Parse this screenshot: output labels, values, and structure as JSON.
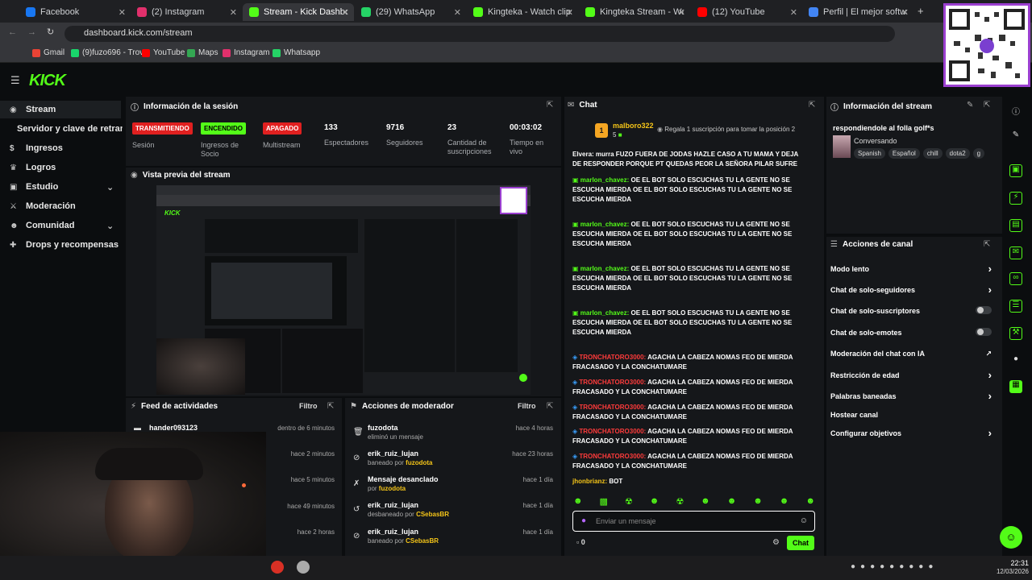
{
  "browser": {
    "tabs": [
      {
        "label": "Facebook",
        "color": "#1877f2"
      },
      {
        "label": "(2) Instagram",
        "color": "#e1306c"
      },
      {
        "label": "Stream - Kick Dashboard",
        "color": "#53fc18"
      },
      {
        "label": "(29) WhatsApp",
        "color": "#25d366"
      },
      {
        "label": "Kingteka - Watch clips on",
        "color": "#53fc18"
      },
      {
        "label": "Kingteka Stream - Watch",
        "color": "#53fc18"
      },
      {
        "label": "(12) YouTube",
        "color": "#ff0000"
      },
      {
        "label": "Perfil | El mejor software",
        "color": "#4285f4"
      }
    ],
    "url": "dashboard.kick.com/stream",
    "bookmarks": [
      {
        "label": "Gmail",
        "color": "#ea4335"
      },
      {
        "label": "(9)fuzo696 - Trovo",
        "color": "#19d66b"
      },
      {
        "label": "YouTube",
        "color": "#ff0000"
      },
      {
        "label": "Maps",
        "color": "#34a853"
      },
      {
        "label": "Instagram",
        "color": "#e1306c"
      },
      {
        "label": "Whatsapp",
        "color": "#25d366"
      }
    ]
  },
  "brand": {
    "logo": "KICK",
    "accent": "#53fc18"
  },
  "sidebar": {
    "items": [
      {
        "label": "Stream",
        "icon": "broadcast-icon"
      },
      {
        "label": "Servidor y clave de retransmisión",
        "icon": ""
      },
      {
        "label": "Ingresos",
        "icon": "money-icon"
      },
      {
        "label": "Logros",
        "icon": "trophy-icon"
      },
      {
        "label": "Estudio",
        "icon": "studio-icon"
      },
      {
        "label": "Moderación",
        "icon": "sword-icon"
      },
      {
        "label": "Comunidad",
        "icon": "people-icon"
      },
      {
        "label": "Drops y recompensas",
        "icon": "gift-icon"
      }
    ]
  },
  "session": {
    "title": "Información de la sesión",
    "stats": [
      {
        "badge": "TRANSMITIENDO",
        "label": "Sesión",
        "badge_color": "#e02020"
      },
      {
        "badge": "ENCENDIDO",
        "label": "Ingresos de Socio",
        "badge_color": "#53fc18"
      },
      {
        "badge": "APAGADO",
        "label": "Multistream",
        "badge_color": "#e02020"
      },
      {
        "value": "133",
        "label": "Espectadores"
      },
      {
        "value": "9716",
        "label": "Seguidores"
      },
      {
        "value": "23",
        "label": "Cantidad de suscripciones"
      },
      {
        "value": "00:03:02",
        "label": "Tiempo en vivo"
      }
    ]
  },
  "preview": {
    "title": "Vista previa del stream"
  },
  "feed": {
    "title": "Feed de actividades",
    "filter": "Filtro",
    "items": [
      {
        "name": "hander093123",
        "time": "dentro de 6 minutos"
      },
      {
        "name": "",
        "time": "hace 2 minutos"
      },
      {
        "name": "",
        "time": "hace 5 minutos"
      },
      {
        "name": "",
        "time": "hace 49 minutos"
      },
      {
        "name": "",
        "time": "hace 2 horas"
      }
    ]
  },
  "modactions": {
    "title": "Acciones de moderador",
    "filter": "Filtro",
    "items": [
      {
        "name": "fuzodota",
        "sub": "eliminó un mensaje",
        "by": "",
        "time": "hace 4 horas"
      },
      {
        "name": "erik_ruiz_lujan",
        "sub": "baneado por ",
        "by": "fuzodota",
        "time": "hace 23 horas"
      },
      {
        "name": "Mensaje desanclado",
        "sub": "por ",
        "by": "fuzodota",
        "time": "hace 1 día"
      },
      {
        "name": "erik_ruiz_lujan",
        "sub": "desbaneado por ",
        "by": "CSebasBR",
        "time": "hace 1 día"
      },
      {
        "name": "erik_ruiz_lujan",
        "sub": "baneado por ",
        "by": "CSebasBR",
        "time": "hace 1 día"
      }
    ]
  },
  "chat": {
    "title": "Chat",
    "top_user": "malboro322",
    "top_count": "5",
    "top_rank": "1",
    "promo": "Regala 1 suscripción para tomar la posición 2",
    "messages": [
      {
        "user": "",
        "text": "Elvera: murra FUZO FUERA DE JODAS HAZLE CASO A TU MAMA Y DEJA DE RESPONDER PORQUE PT QUEDAS PEOR LA SEÑORA PILAR SUFRE",
        "kind": "y"
      },
      {
        "user": "marlon_chavez:",
        "text": " OE EL BOT SOLO ESCUCHAS TU LA GENTE NO SE ESCUCHA MIERDA   OE EL BOT SOLO ESCUCHAS TU LA GENTE NO SE ESCUCHA MIERDA",
        "kind": "g"
      },
      {
        "user": "marlon_chavez:",
        "text": " OE EL BOT SOLO ESCUCHAS TU LA GENTE NO SE ESCUCHA MIERDA   OE EL BOT SOLO ESCUCHAS TU LA GENTE NO SE ESCUCHA MIERDA",
        "kind": "g"
      },
      {
        "user": "marlon_chavez:",
        "text": " OE EL BOT SOLO ESCUCHAS TU LA GENTE NO SE ESCUCHA MIERDA   OE EL BOT SOLO ESCUCHAS TU LA GENTE NO SE ESCUCHA MIERDA",
        "kind": "g"
      },
      {
        "user": "marlon_chavez:",
        "text": " OE EL BOT SOLO ESCUCHAS TU LA GENTE NO SE ESCUCHA MIERDA   OE EL BOT SOLO ESCUCHAS TU LA GENTE NO SE ESCUCHA MIERDA",
        "kind": "g"
      },
      {
        "user": "TRONCHATORO3000:",
        "text": " AGACHA LA CABEZA NOMAS FEO DE MIERDA FRACASADO Y LA CONCHATUMARE",
        "kind": "r"
      },
      {
        "user": "TRONCHATORO3000:",
        "text": " AGACHA LA CABEZA NOMAS FEO DE MIERDA FRACASADO Y LA CONCHATUMARE",
        "kind": "r"
      },
      {
        "user": "TRONCHATORO3000:",
        "text": " AGACHA LA CABEZA NOMAS FEO DE MIERDA FRACASADO Y LA CONCHATUMARE",
        "kind": "r"
      },
      {
        "user": "TRONCHATORO3000:",
        "text": " AGACHA LA CABEZA NOMAS FEO DE MIERDA FRACASADO Y LA CONCHATUMARE",
        "kind": "r"
      },
      {
        "user": "TRONCHATORO3000:",
        "text": " AGACHA LA CABEZA NOMAS FEO DE MIERDA FRACASADO Y LA CONCHATUMARE",
        "kind": "r"
      },
      {
        "user": "jhonbrianz:",
        "text": " BOT",
        "kind": "y"
      }
    ],
    "input_placeholder": "Enviar un mensaje",
    "points": "0",
    "send_label": "Chat"
  },
  "streaminfo": {
    "title": "Información del stream",
    "stream_title": "respondiendole al folla golf*s",
    "category": "Conversando",
    "tags": [
      "Spanish",
      "Español",
      "chill",
      "dota2",
      "g"
    ]
  },
  "channel_actions": {
    "title": "Acciones de canal",
    "items": [
      {
        "label": "Modo lento",
        "control": "chevron"
      },
      {
        "label": "Chat de solo-seguidores",
        "control": "chevron"
      },
      {
        "label": "Chat de solo-suscriptores",
        "control": "toggle"
      },
      {
        "label": "Chat de solo-emotes",
        "control": "toggle"
      },
      {
        "label": "Moderación del chat con IA",
        "control": "external"
      },
      {
        "label": "Restricción de edad",
        "control": "chevron"
      },
      {
        "label": "Palabras baneadas",
        "control": "chevron"
      },
      {
        "label": "Hostear canal",
        "control": "none"
      },
      {
        "label": "Configurar objetivos",
        "control": "chevron"
      }
    ]
  },
  "taskbar": {
    "time": "22:31",
    "date": "12/03/2026"
  }
}
